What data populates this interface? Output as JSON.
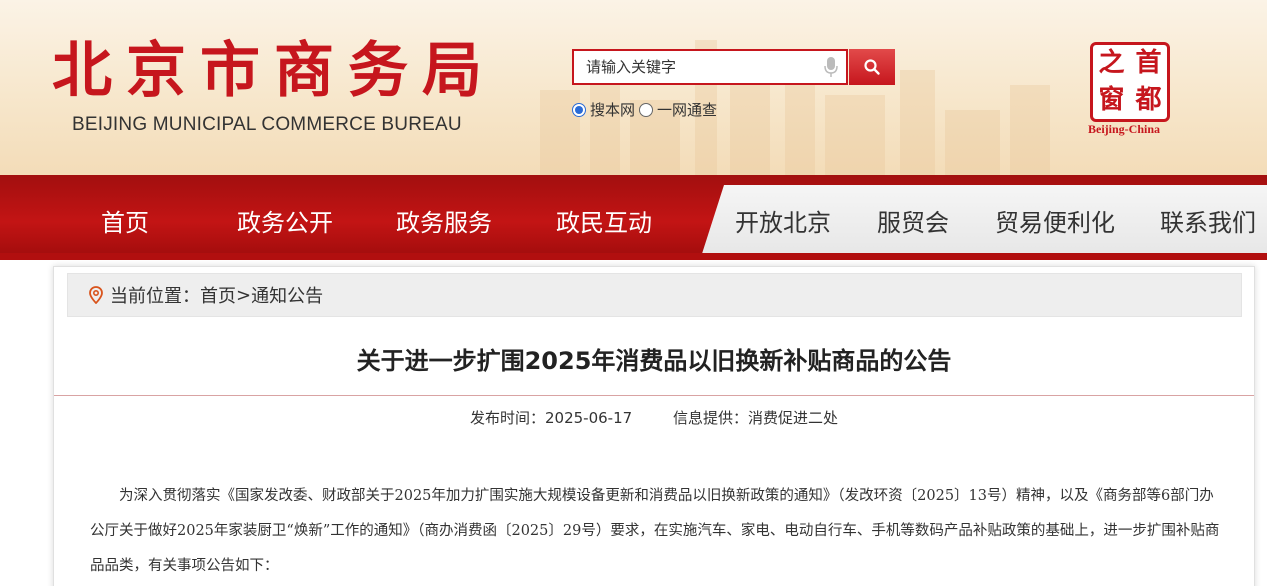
{
  "header": {
    "logo_cn": "北京市商务局",
    "logo_en": "BEIJING MUNICIPAL COMMERCE BUREAU",
    "search": {
      "placeholder": "请输入关键字"
    },
    "scope_options": [
      {
        "label": "搜本网",
        "selected": true
      },
      {
        "label": "一网通查",
        "selected": false
      }
    ],
    "seal": {
      "chars": [
        "之",
        "首",
        "窗",
        "都"
      ],
      "en": "Beijing-China"
    }
  },
  "nav": {
    "items": [
      {
        "label": "首页"
      },
      {
        "label": "政务公开"
      },
      {
        "label": "政务服务"
      },
      {
        "label": "政民互动"
      },
      {
        "label": "开放北京"
      },
      {
        "label": "服贸会"
      },
      {
        "label": "贸易便利化"
      },
      {
        "label": "联系我们"
      }
    ]
  },
  "breadcrumb": {
    "prefix": "当前位置：",
    "home": "首页",
    "separator": ">",
    "current": "通知公告"
  },
  "article": {
    "title": "关于进一步扩围2025年消费品以旧换新补贴商品的公告",
    "publish_time": "发布时间：2025-06-17",
    "source": "信息提供：消费促进二处",
    "paragraph": "为深入贯彻落实《国家发改委、财政部关于2025年加力扩围实施大规模设备更新和消费品以旧换新政策的通知》（发改环资〔2025〕13号）精神，以及《商务部等6部门办公厅关于做好2025年家装厨卫“焕新”工作的通知》（商办消费函〔2025〕29号）要求，在实施汽车、家电、电动自行车、手机等数码产品补贴政策的基础上，进一步扩围补贴商品品类，有关事项公告如下："
  },
  "colors": {
    "brand_red": "#c6161d",
    "nav_red": "#b10f0f",
    "nav_gray": "#e6e6e6"
  }
}
